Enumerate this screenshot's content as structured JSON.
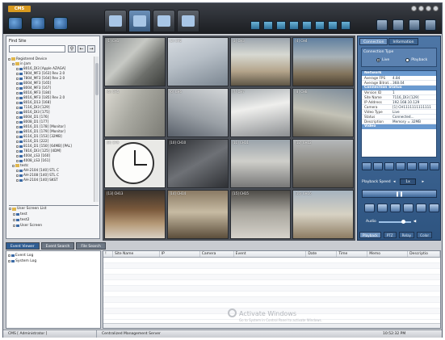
{
  "app": {
    "logo": "CMS"
  },
  "left": {
    "find_site_label": "Find Site",
    "find_site_value": "",
    "tree": [
      {
        "label": "Registered Device",
        "depth": 0,
        "folder": true
      },
      {
        "label": "in Jam",
        "depth": 1,
        "folder": true
      },
      {
        "label": "8016_DI3 [Apple AZAGA]",
        "depth": 2
      },
      {
        "label": "7804_MF3 [163] Rev 2.0",
        "depth": 2
      },
      {
        "label": "7804_MF3 [164] Rev 2.0",
        "depth": 2
      },
      {
        "label": "8004_MF3 [165]",
        "depth": 2
      },
      {
        "label": "8004_MF3 [167]",
        "depth": 2
      },
      {
        "label": "8016_MF3 [184]",
        "depth": 2
      },
      {
        "label": "8016_MF3 [185] Rev 2.0",
        "depth": 2
      },
      {
        "label": "8016_D13 [168]",
        "depth": 2
      },
      {
        "label": "7116_DI3 [129]",
        "depth": 2
      },
      {
        "label": "8016_DI3 [175]",
        "depth": 2
      },
      {
        "label": "8004_D1 [176]",
        "depth": 2
      },
      {
        "label": "8008_D1 [177]",
        "depth": 2
      },
      {
        "label": "8016_D1 [178] [Monitor]",
        "depth": 2
      },
      {
        "label": "8016_D1 [179] [Monitor]",
        "depth": 2
      },
      {
        "label": "8116_D1 [153] [32MB]",
        "depth": 2
      },
      {
        "label": "8116_D1 [222]",
        "depth": 2
      },
      {
        "label": "8116_D1 [150] [64MB] [PAL]",
        "depth": 2
      },
      {
        "label": "7816_DI3 [125] [4DM]",
        "depth": 2
      },
      {
        "label": "4004_LS3 [160]",
        "depth": 2
      },
      {
        "label": "4008_LS3 [161]",
        "depth": 2
      },
      {
        "label": "testc",
        "depth": 1,
        "folder": true
      },
      {
        "label": "AH-2104 [140] STL C",
        "depth": 2
      },
      {
        "label": "AH-2108 [140] STL C",
        "depth": 2
      },
      {
        "label": "AH-2104 [140] SKST",
        "depth": 2
      }
    ],
    "user_screens": [
      {
        "label": "User Screen List",
        "depth": 0,
        "folder": true
      },
      {
        "label": "test",
        "depth": 1
      },
      {
        "label": "test2",
        "depth": 1
      },
      {
        "label": "User Screen",
        "depth": 1
      }
    ]
  },
  "grid": {
    "cells": [
      {
        "label": "[1] CH1",
        "style": "c-a"
      },
      {
        "label": "[2] CH2",
        "style": "c-b"
      },
      {
        "label": "[3] CH3",
        "style": "c-c"
      },
      {
        "label": "[4] CH4",
        "style": "c-d"
      },
      {
        "label": "[5] CH5",
        "style": "c-e"
      },
      {
        "label": "[6] CH6",
        "style": "c-f"
      },
      {
        "label": "[7] CH7",
        "style": "c-g"
      },
      {
        "label": "[8] CH8",
        "style": "c-h"
      },
      {
        "label": "[9] CH9",
        "style": "c-i",
        "clock": true
      },
      {
        "label": "[10] CH10",
        "style": "c-j"
      },
      {
        "label": "[11] CH11",
        "style": "c-k"
      },
      {
        "label": "[12] CH12",
        "style": "c-l"
      },
      {
        "label": "[13] CH13",
        "style": "c-m"
      },
      {
        "label": "[14] CH14",
        "style": "c-n"
      },
      {
        "label": "[15] CH15",
        "style": "c-o"
      },
      {
        "label": "[16] CH16",
        "style": "c-p"
      }
    ]
  },
  "right": {
    "tab_connection": "Connection",
    "tab_other": "Information",
    "connection_type_label": "Connection Type",
    "radio_live": "Live",
    "radio_playback": "Playback",
    "sections": [
      {
        "header": "Network",
        "rows": [
          {
            "k": "Average FPS",
            "v": "4.84"
          },
          {
            "k": "Average Bitrat...",
            "v": "368.04"
          }
        ]
      },
      {
        "header": "Connection Status",
        "rows": [
          {
            "k": "Version ID",
            "v": "1"
          },
          {
            "k": "Site Name",
            "v": "7116_DI3 [129]"
          },
          {
            "k": "IP Address",
            "v": "192.168.10.129"
          },
          {
            "k": "Camera",
            "v": "[1] CH1111111111111"
          },
          {
            "k": "Video Type",
            "v": "Live"
          },
          {
            "k": "Status",
            "v": "Connected..."
          },
          {
            "k": "Description",
            "v": "Memory = 32MB"
          }
        ]
      },
      {
        "header": "Video",
        "rows": []
      }
    ],
    "playback_speed_label": "Playback Speed",
    "playback_speed_value": "1x",
    "audio_label": "Audio",
    "bottom_tabs": [
      "Playback",
      "PTZ",
      "Relay",
      "Color"
    ]
  },
  "events": {
    "tabs": [
      "Event Viewer",
      "Event Search",
      "File Search"
    ],
    "tree": [
      {
        "label": "Event Log",
        "depth": 0
      },
      {
        "label": "System Log",
        "depth": 0
      }
    ],
    "columns": [
      "!",
      "Site Name",
      "IP",
      "Camera",
      "Event",
      "Date",
      "Time",
      "Memo",
      "Descriptio"
    ],
    "col_widths": [
      12,
      58,
      50,
      42,
      90,
      38,
      38,
      50,
      40
    ],
    "rows": 11
  },
  "watermark": {
    "title": "Activate Windows",
    "sub": "Go to System in Control Panel to activate Windows."
  },
  "status": {
    "user": "CMS [ Administrator ]",
    "app_name": "Centralized Management Server",
    "time": "10:52:32 PM"
  },
  "colors": {
    "accent": "#2f5d92",
    "panel_blue": "#4d76a6",
    "logo": "#d99a1f"
  }
}
